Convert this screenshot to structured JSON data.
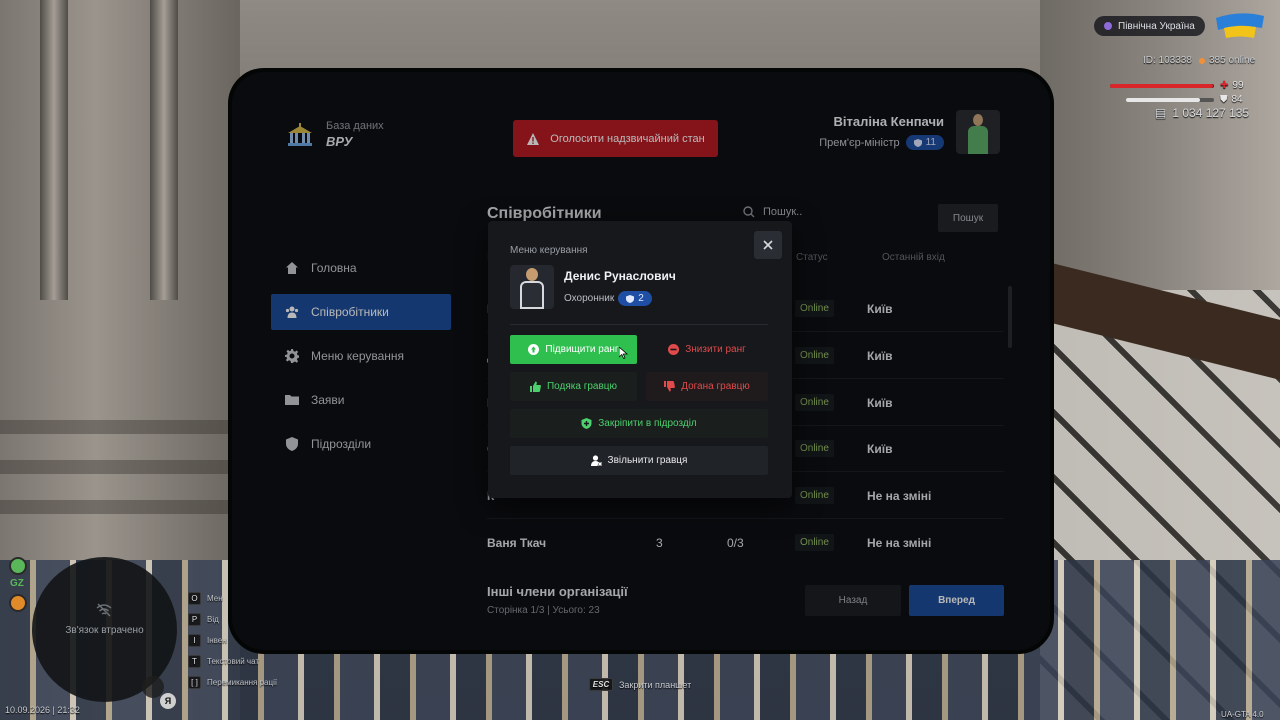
{
  "brand": {
    "subtitle": "База даних",
    "name": "ВРУ"
  },
  "emergency_label": "Оголосити надзвичайний стан",
  "user": {
    "name": "Віталіна Кенпачи",
    "role": "Прем'єр-міністр",
    "rank": "11"
  },
  "sidebar": {
    "items": [
      {
        "label": "Головна",
        "icon": "home-icon",
        "active": false
      },
      {
        "label": "Співробітники",
        "icon": "users-icon",
        "active": true
      },
      {
        "label": "Меню керування",
        "icon": "gear-icon",
        "active": false
      },
      {
        "label": "Заяви",
        "icon": "folder-icon",
        "active": false
      },
      {
        "label": "Підрозділи",
        "icon": "shield-icon",
        "active": false
      }
    ]
  },
  "main": {
    "title": "Співробітники",
    "search_placeholder": "Пошук..",
    "search_button": "Пошук",
    "columns": {
      "id": "І",
      "status": "Статус",
      "last_login": "Останній вхід"
    },
    "rows": [
      {
        "name": "N",
        "rank": "",
        "warnings": "",
        "status": "Online",
        "location": "Київ"
      },
      {
        "name": "Д",
        "rank": "",
        "warnings": "",
        "status": "Online",
        "location": "Київ"
      },
      {
        "name": "В",
        "rank": "",
        "warnings": "",
        "status": "Online",
        "location": "Київ"
      },
      {
        "name": "Є",
        "rank": "",
        "warnings": "",
        "status": "Online",
        "location": "Київ"
      },
      {
        "name": "К",
        "rank": "",
        "warnings": "",
        "status": "Online",
        "location": "Не на зміні"
      },
      {
        "name": "Ваня Ткач",
        "rank": "3",
        "warnings": "0/3",
        "status": "Online",
        "location": "Не на зміні"
      }
    ],
    "others_title": "Інші члени організації",
    "page_info": "Сторінка 1/3 | Усього: 23",
    "back_label": "Назад",
    "next_label": "Вперед"
  },
  "modal": {
    "title": "Меню керування",
    "member_name": "Денис Рунаслович",
    "member_role": "Охоронник",
    "member_rank": "2",
    "promote": "Підвищити ранг",
    "demote": "Знизити ранг",
    "thanks": "Подяка гравцю",
    "rebuke": "Догана гравцю",
    "assign": "Закріпити в підрозділ",
    "fire": "Звільнити гравця"
  },
  "hud": {
    "region": "Північна Україна",
    "player_id": "ID: 103338",
    "online": "385 online",
    "health": "99",
    "armor": "84",
    "health_level": 0.99,
    "armor_level": 0.84,
    "money": "1 034 127 135",
    "minimap_text": "Зв'язок втрачено",
    "gz_label": "GZ",
    "date": "10.09.2026 | 21:32",
    "mic_key": "Я",
    "version": "UA-GTA 4.0",
    "esc_key": "ESC",
    "esc_label": "Закрити планшет",
    "keys": [
      {
        "key": "O",
        "label": "Мен"
      },
      {
        "key": "P",
        "label": "Від"
      },
      {
        "key": "I",
        "label": "Інвен"
      },
      {
        "key": "T",
        "label": "Текстовий чат"
      },
      {
        "key": "[ ]",
        "label": "Перемикання рації"
      }
    ]
  }
}
